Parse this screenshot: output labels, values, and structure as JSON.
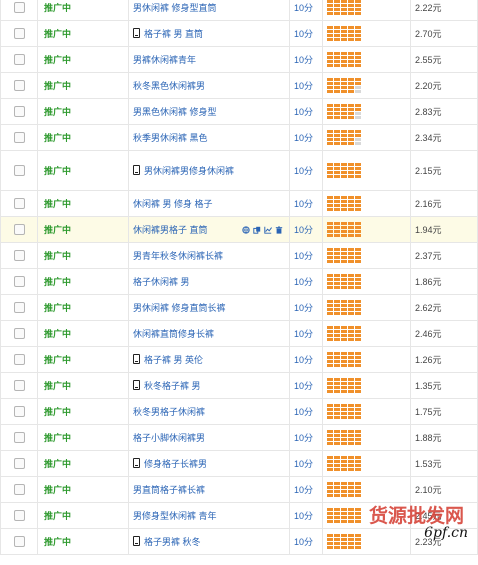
{
  "quality_unit": "分",
  "colors": {
    "status_green": "#2f9a2f",
    "keyword_blue": "#2a64b5",
    "gauge_on": "#f0902a",
    "gauge_off": "#d8d8d8",
    "selected_row": "#fdfbe6"
  },
  "rows": [
    {
      "status": "推广中",
      "keyword": "男休闲裤 修身型直筒",
      "mobile": false,
      "quality": "10分",
      "gauge_level": 20,
      "price": "2.22元",
      "selected": false
    },
    {
      "status": "推广中",
      "keyword": "格子裤 男 直筒",
      "mobile": true,
      "quality": "10分",
      "gauge_level": 20,
      "price": "2.70元",
      "selected": false
    },
    {
      "status": "推广中",
      "keyword": "男裤休闲裤青年",
      "mobile": false,
      "quality": "10分",
      "gauge_level": 20,
      "price": "2.55元",
      "selected": false
    },
    {
      "status": "推广中",
      "keyword": "秋冬黑色休闲裤男",
      "mobile": false,
      "quality": "10分",
      "gauge_level": 18,
      "price": "2.20元",
      "selected": false
    },
    {
      "status": "推广中",
      "keyword": "男黑色休闲裤 修身型",
      "mobile": false,
      "quality": "10分",
      "gauge_level": 18,
      "price": "2.83元",
      "selected": false
    },
    {
      "status": "推广中",
      "keyword": "秋季男休闲裤 黑色",
      "mobile": false,
      "quality": "10分",
      "gauge_level": 18,
      "price": "2.34元",
      "selected": false
    },
    {
      "status": "推广中",
      "keyword": "男休闲裤男修身休闲裤",
      "mobile": true,
      "quality": "10分",
      "gauge_level": 20,
      "price": "2.15元",
      "selected": false,
      "tall": true
    },
    {
      "status": "推广中",
      "keyword": "休闲裤 男 修身 格子",
      "mobile": false,
      "quality": "10分",
      "gauge_level": 20,
      "price": "2.16元",
      "selected": false
    },
    {
      "status": "推广中",
      "keyword": "休闲裤男格子 直筒",
      "mobile": false,
      "quality": "10分",
      "gauge_level": 20,
      "price": "1.94元",
      "selected": true,
      "actions": [
        {
          "icon": "globe-icon"
        },
        {
          "icon": "copy-icon"
        },
        {
          "icon": "trend-chart-icon"
        },
        {
          "icon": "trash-icon"
        }
      ]
    },
    {
      "status": "推广中",
      "keyword": "男青年秋冬休闲裤长裤",
      "mobile": false,
      "quality": "10分",
      "gauge_level": 20,
      "price": "2.37元",
      "selected": false
    },
    {
      "status": "推广中",
      "keyword": "格子休闲裤 男",
      "mobile": false,
      "quality": "10分",
      "gauge_level": 20,
      "price": "1.86元",
      "selected": false
    },
    {
      "status": "推广中",
      "keyword": "男休闲裤 修身直筒长裤",
      "mobile": false,
      "quality": "10分",
      "gauge_level": 20,
      "price": "2.62元",
      "selected": false
    },
    {
      "status": "推广中",
      "keyword": "休闲裤直筒修身长裤",
      "mobile": false,
      "quality": "10分",
      "gauge_level": 20,
      "price": "2.46元",
      "selected": false
    },
    {
      "status": "推广中",
      "keyword": "格子裤 男 英伦",
      "mobile": true,
      "quality": "10分",
      "gauge_level": 20,
      "price": "1.26元",
      "selected": false
    },
    {
      "status": "推广中",
      "keyword": "秋冬格子裤 男",
      "mobile": true,
      "quality": "10分",
      "gauge_level": 20,
      "price": "1.35元",
      "selected": false
    },
    {
      "status": "推广中",
      "keyword": "秋冬男格子休闲裤",
      "mobile": false,
      "quality": "10分",
      "gauge_level": 20,
      "price": "1.75元",
      "selected": false
    },
    {
      "status": "推广中",
      "keyword": "格子小脚休闲裤男",
      "mobile": false,
      "quality": "10分",
      "gauge_level": 20,
      "price": "1.88元",
      "selected": false
    },
    {
      "status": "推广中",
      "keyword": "修身格子长裤男",
      "mobile": true,
      "quality": "10分",
      "gauge_level": 20,
      "price": "1.53元",
      "selected": false
    },
    {
      "status": "推广中",
      "keyword": "男直筒格子裤长裤",
      "mobile": false,
      "quality": "10分",
      "gauge_level": 20,
      "price": "2.10元",
      "selected": false
    },
    {
      "status": "推广中",
      "keyword": "男修身型休闲裤 青年",
      "mobile": false,
      "quality": "10分",
      "gauge_level": 20,
      "price": "2.45元",
      "selected": false
    },
    {
      "status": "推广中",
      "keyword": "格子男裤 秋冬",
      "mobile": true,
      "quality": "10分",
      "gauge_level": 20,
      "price": "2.23元",
      "selected": false
    }
  ],
  "watermark": {
    "site_name": "货源批发网",
    "url": "6pf.cn"
  }
}
